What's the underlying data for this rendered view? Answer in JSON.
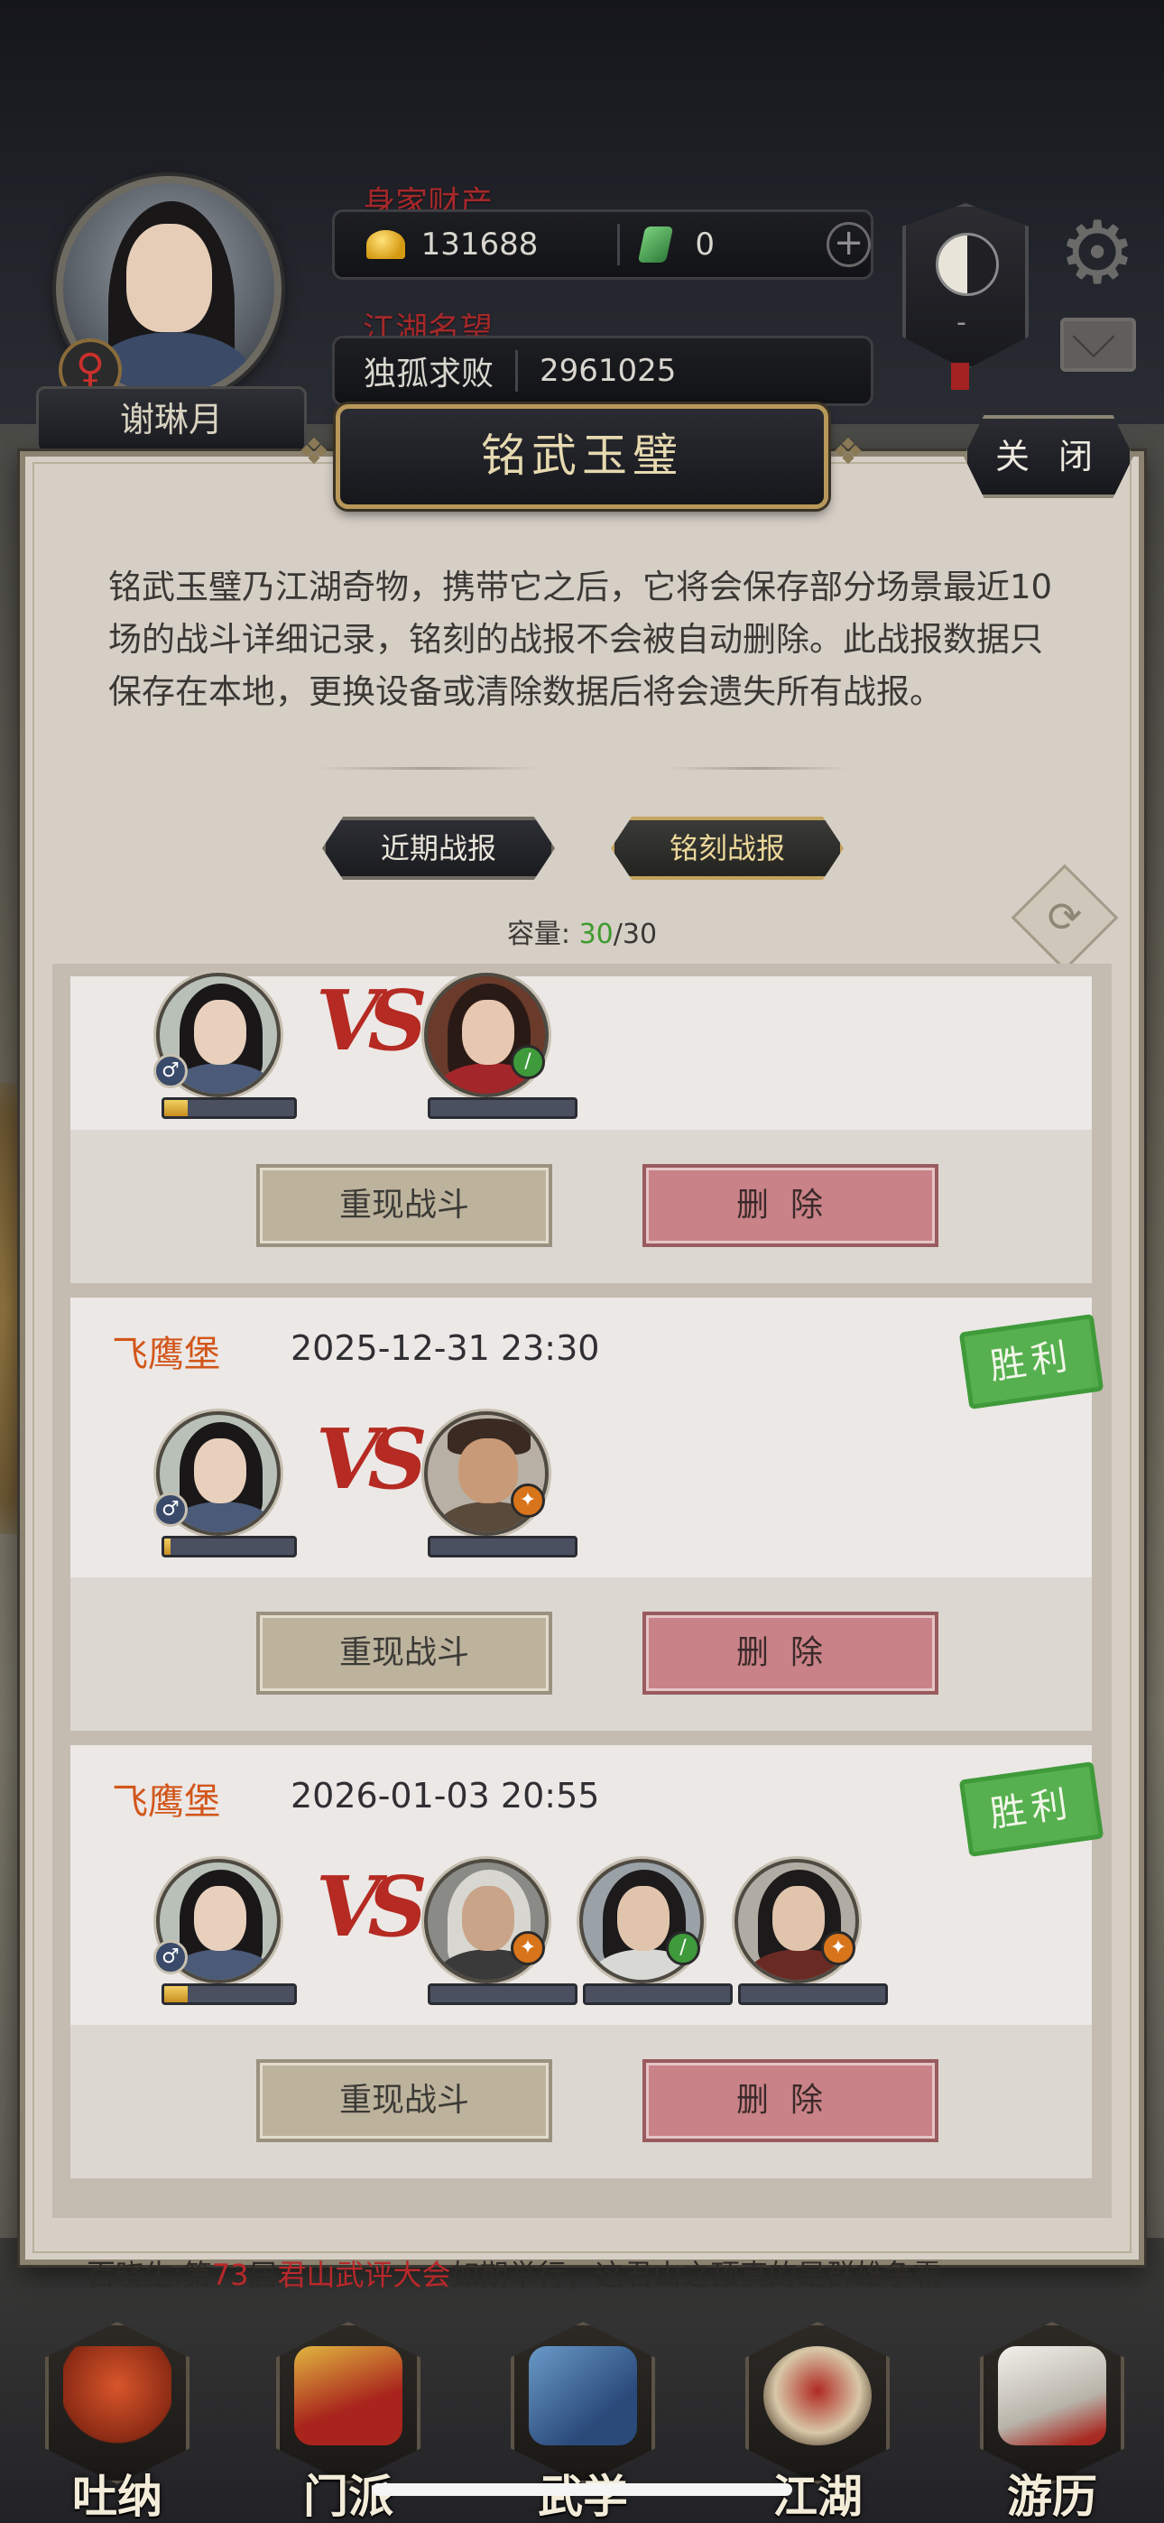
{
  "header": {
    "player_name": "谢琳月",
    "gender_icon": "♀",
    "wealth_label": "身家财产",
    "gold": "131688",
    "jade": "0",
    "plus": "+",
    "fame_label": "江湖名望",
    "fame_title": "独孤求败",
    "fame_value": "2961025",
    "sect_dash": "-"
  },
  "modal": {
    "title": "铭武玉璧",
    "close_label": "关 闭",
    "description": "铭武玉璧乃江湖奇物，携带它之后，它将会保存部分场景最近10场的战斗详细记录，铭刻的战报不会被自动删除。此战报数据只保存在本地，更换设备或清除数据后将会遗失所有战报。",
    "tabs": [
      {
        "label": "近期战报",
        "active": false
      },
      {
        "label": "铭刻战报",
        "active": true
      }
    ],
    "capacity_label": "容量:",
    "capacity_current": "30",
    "capacity_total": "/30"
  },
  "records": [
    {
      "location": "",
      "timestamp": "",
      "result": "",
      "player_hp": 0.18,
      "opponents": [
        {
          "portrait": "red-armored-woman",
          "badge": "green"
        }
      ],
      "replay_label": "重现战斗",
      "delete_label": "删除"
    },
    {
      "location": "飞鹰堡",
      "timestamp": "2025-12-31 23:30",
      "result": "胜利",
      "player_hp": 0.05,
      "opponents": [
        {
          "portrait": "bald-bearded-man",
          "badge": "orange"
        }
      ],
      "replay_label": "重现战斗",
      "delete_label": "删除"
    },
    {
      "location": "飞鹰堡",
      "timestamp": "2026-01-03 20:55",
      "result": "胜利",
      "player_hp": 0.18,
      "opponents": [
        {
          "portrait": "white-haired-elder",
          "badge": "orange"
        },
        {
          "portrait": "young-swordsman",
          "badge": "green"
        },
        {
          "portrait": "topknot-warrior",
          "badge": "orange"
        }
      ],
      "replay_label": "重现战斗",
      "delete_label": "删除"
    }
  ],
  "vs_text": "VS",
  "ticker": {
    "prefix": "百晓生:第",
    "number": "73",
    "mid": "届",
    "event": "君山武评大会",
    "suffix": "如期举行，这君山之顶真的是群雄争霸"
  },
  "nav": [
    {
      "label": "吐纳",
      "icon": "meditation-icon"
    },
    {
      "label": "门派",
      "icon": "sect-banner-icon"
    },
    {
      "label": "武学",
      "icon": "scroll-books-icon"
    },
    {
      "label": "江湖",
      "icon": "bamboo-hat-icon"
    },
    {
      "label": "游历",
      "icon": "white-horse-icon"
    }
  ],
  "colors": {
    "accent_gold": "#c3a460",
    "win_green": "#4aaa42",
    "location_orange": "#d2561a",
    "delete_red": "#c98287"
  }
}
